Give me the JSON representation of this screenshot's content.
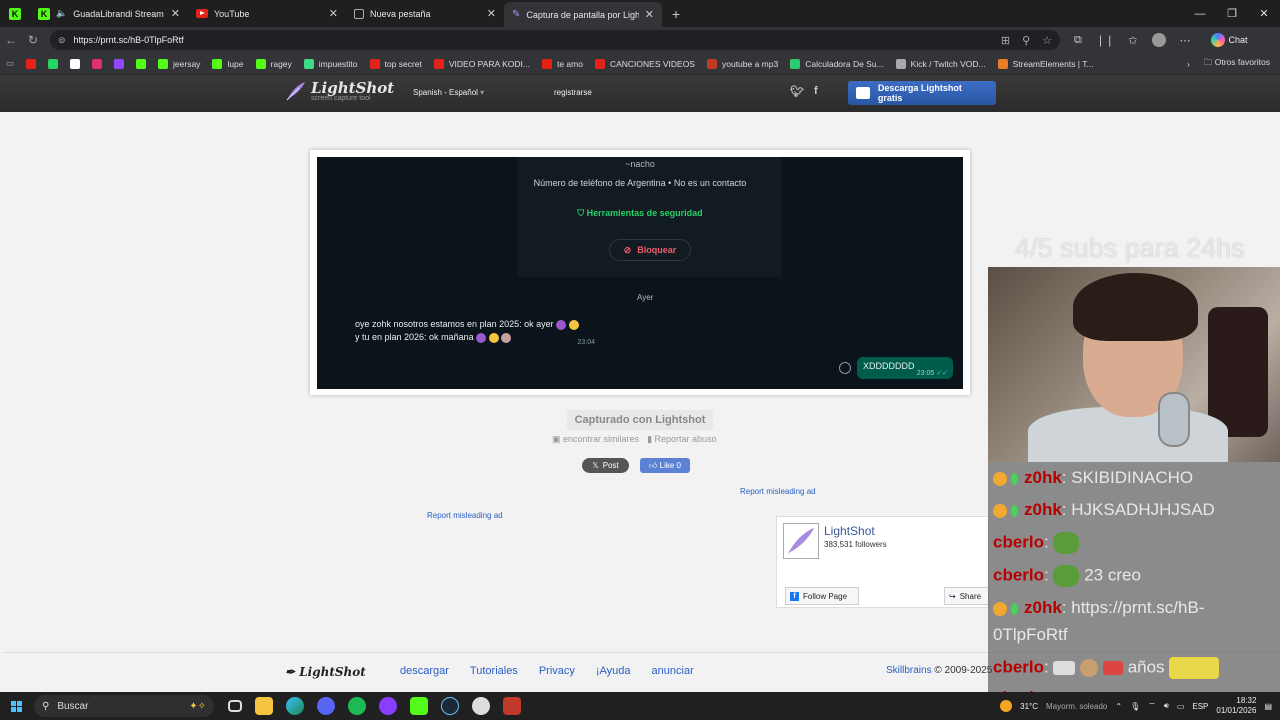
{
  "browser": {
    "tabs": [
      {
        "label": "GuadaLibrandi Stream - Watc",
        "type": "kick"
      },
      {
        "label": "YouTube",
        "type": "youtube"
      },
      {
        "label": "Nueva pestaña",
        "type": "newtab"
      },
      {
        "label": "Captura de pantalla por Lightshot",
        "type": "lightshot",
        "active": true
      }
    ],
    "url": "https://prnt.sc/hB-0TlpFoRtf",
    "chat_label": "Chat",
    "bookmarks": [
      {
        "label": "",
        "color": "#e62117"
      },
      {
        "label": "",
        "color": "#25d366"
      },
      {
        "label": "",
        "color": "#ffffff"
      },
      {
        "label": "",
        "color": "#e1306c"
      },
      {
        "label": "",
        "color": "#9146ff"
      },
      {
        "label": "",
        "color": "#53fc18"
      },
      {
        "label": "jeersay",
        "color": "#53fc18"
      },
      {
        "label": "lupe",
        "color": "#53fc18"
      },
      {
        "label": "ragey",
        "color": "#53fc18"
      },
      {
        "label": "impuestito",
        "color": "#3ddc84"
      },
      {
        "label": "top secret",
        "color": "#e62117"
      },
      {
        "label": "VIDEO PARA KODI...",
        "color": "#e62117"
      },
      {
        "label": "te amo",
        "color": "#e62117"
      },
      {
        "label": "CANCIONES VIDEOS",
        "color": "#e62117"
      },
      {
        "label": "youtube a mp3",
        "color": "#c0392b"
      },
      {
        "label": "Calculadora De Su...",
        "color": "#2ecc71"
      },
      {
        "label": "Kick / Twitch VOD...",
        "color": "#aaaaaa"
      },
      {
        "label": "StreamElements | T...",
        "color": "#e67e22"
      }
    ],
    "other_favorites": "Otros favoritos"
  },
  "lightshot": {
    "logo_text": "LightShot",
    "logo_sub": "screen capture tool",
    "language": "Spanish - Español",
    "register": "registrarse",
    "download_button": "Descarga Lightshot gratis",
    "screenshot": {
      "contact_name": "~nacho",
      "phone_info": "Número de teléfono de Argentina • No es un contacto",
      "security_tools": "Herramientas de seguridad",
      "block": "Bloquear",
      "day_label": "Ayer",
      "incoming_line1": "oye zohk nosotros estamos en plan 2025: ok ayer",
      "incoming_line2": "y tu en plan 2026: ok mañana",
      "incoming_time": "23:04",
      "outgoing_text": "XDDDDDDD",
      "outgoing_time": "23:05"
    },
    "captured_label": "Capturado con Lightshot",
    "find_similar": "encontrar similares",
    "report_abuse": "Reportar abuso",
    "x_post": "Post",
    "fb_like": "Like 0",
    "report_ad_1": "Report misleading ad",
    "report_ad_2": "Report misleading ad",
    "fb_page": {
      "name": "LightShot",
      "followers": "383,531 followers",
      "follow": "Follow Page",
      "share": "Share"
    },
    "footer": {
      "logo": "LightShot",
      "links": [
        "descargar",
        "Tutoriales",
        "Privacy",
        "¡Ayuda",
        "anunciar"
      ],
      "company": "Skillbrains",
      "copyright": "© 2009-2025"
    }
  },
  "overlay": {
    "subs_text": "4/5 subs para 24hs",
    "chat": [
      {
        "user": "z0hk",
        "msg": "SKIBIDINACHO"
      },
      {
        "user": "z0hk",
        "msg": "HJKSADHJHJSAD"
      },
      {
        "user": "cberlo",
        "msg": ""
      },
      {
        "user": "cberlo",
        "msg": "23 creo"
      },
      {
        "user": "z0hk",
        "msg": "https://prnt.sc/hB-"
      },
      {
        "user": "",
        "msg": "0TlpFoRtf"
      },
      {
        "user": "cberlo",
        "msg": "años"
      },
      {
        "user": "cberlo",
        "msg": ""
      }
    ]
  },
  "taskbar": {
    "search_placeholder": "Buscar",
    "temperature": "31°C",
    "weather": "Mayorm. soleado",
    "language": "ESP",
    "time": "18:32",
    "date": "01/01/2026"
  }
}
